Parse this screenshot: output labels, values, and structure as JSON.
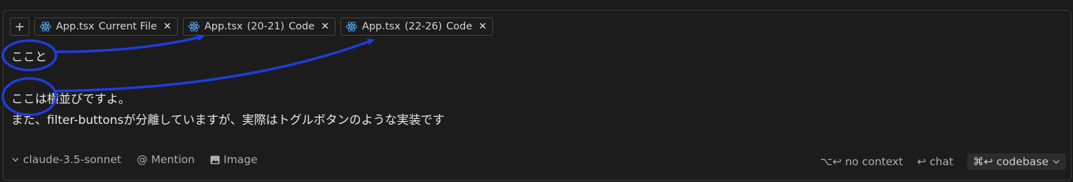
{
  "tabs": {
    "add_label": "+",
    "chips": [
      {
        "file": "App.tsx",
        "suffix": "Current File",
        "close": "✕"
      },
      {
        "file": "App.tsx",
        "suffix": "(20-21)",
        "kind": "Code",
        "close": "✕"
      },
      {
        "file": "App.tsx",
        "suffix": "(22-26)",
        "kind": "Code",
        "close": "✕"
      }
    ]
  },
  "editor": {
    "line1": "ここと",
    "line2": "ここは横並びですよ。",
    "line3": "また、filter-buttonsが分離していますが、実際はトグルボタンのような実装です"
  },
  "footer": {
    "model": "claude-3.5-sonnet",
    "mention": "Mention",
    "image": "Image",
    "no_context_keys": "⌥↩",
    "no_context": "no context",
    "chat_keys": "↩",
    "chat": "chat",
    "codebase_keys": "⌘↩",
    "codebase": "codebase"
  },
  "colors": {
    "annotation": "#1f3de0",
    "react_icon": "#5aa9f0",
    "background": "#1b1b1b"
  }
}
